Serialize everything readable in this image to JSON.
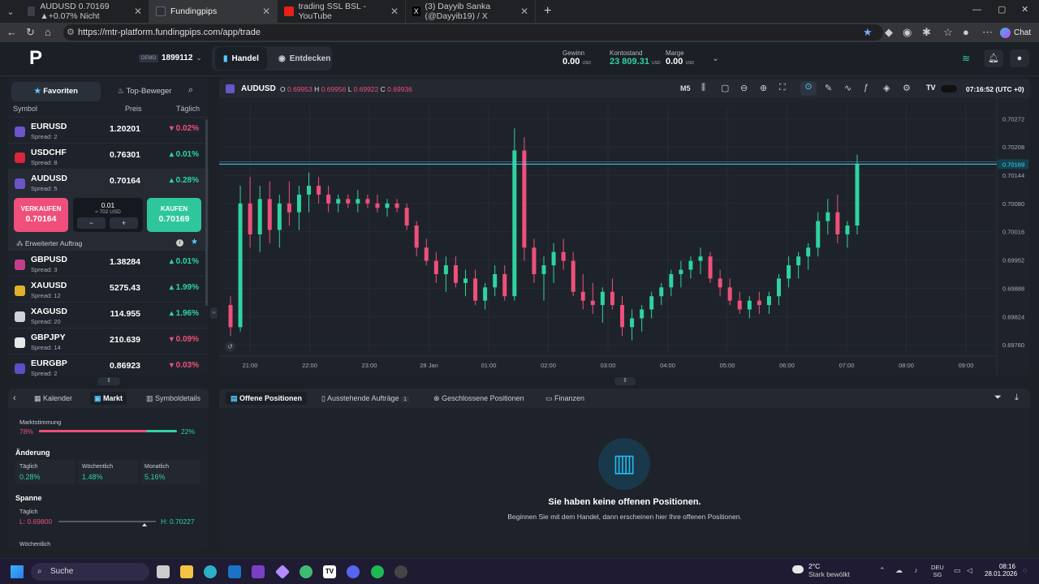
{
  "browser": {
    "tabs": [
      {
        "title": "AUDUSD 0.70169 ▲+0.07% Nicht",
        "color": "#3a3f4b"
      },
      {
        "title": "Fundingpips",
        "color": "#2b2f3a"
      },
      {
        "title": "trading SSL BSL - YouTube",
        "color": "#e62117"
      },
      {
        "title": "(3) Dayyib Sanka (@Dayyib19) / X",
        "color": "#000000"
      }
    ],
    "url": "https://mtr-platform.fundingpips.com/app/trade",
    "chat_label": "Chat"
  },
  "header": {
    "logo": "P",
    "demo_badge": "DEMO",
    "account_id": "1899112",
    "tab_trade": "Handel",
    "tab_explore": "Entdecken",
    "profit_label": "Gewinn",
    "profit_value": "0.00",
    "profit_unit": "USD",
    "balance_label": "Kontostand",
    "balance_value": "23 809.31",
    "balance_unit": "USD",
    "margin_label": "Marge",
    "margin_value": "0.00",
    "margin_unit": "USD"
  },
  "watchlist": {
    "tab_favorites": "Favoriten",
    "tab_movers": "Top-Beweger",
    "col_symbol": "Symbol",
    "col_price": "Preis",
    "col_daily": "Täglich",
    "rows": [
      {
        "symbol": "EURUSD",
        "spread": "Spread: 2",
        "price": "1.20201",
        "change": "0.02%",
        "dir": "down",
        "flag": "#6a55c9"
      },
      {
        "symbol": "USDCHF",
        "spread": "Spread: 8",
        "price": "0.76301",
        "change": "0.01%",
        "dir": "up",
        "flag": "#d7263d"
      },
      {
        "symbol": "AUDUSD",
        "spread": "Spread: 5",
        "price": "0.70164",
        "change": "0.28%",
        "dir": "up",
        "flag": "#6a55c9"
      }
    ],
    "rows2": [
      {
        "symbol": "GBPUSD",
        "spread": "Spread: 3",
        "price": "1.38284",
        "change": "0.01%",
        "dir": "up",
        "flag": "#c43d8b"
      },
      {
        "symbol": "XAUUSD",
        "spread": "Spread: 12",
        "price": "5275.43",
        "change": "1.99%",
        "dir": "up",
        "flag": "#e0b12a"
      },
      {
        "symbol": "XAGUSD",
        "spread": "Spread: 20",
        "price": "114.955",
        "change": "1.96%",
        "dir": "up",
        "flag": "#cfd3d8"
      },
      {
        "symbol": "GBPJPY",
        "spread": "Spread: 14",
        "price": "210.639",
        "change": "0.09%",
        "dir": "down",
        "flag": "#e8e8e8"
      },
      {
        "symbol": "EURGBP",
        "spread": "Spread: 2",
        "price": "0.86923",
        "change": "0.03%",
        "dir": "down",
        "flag": "#5a4fc4"
      }
    ],
    "sell_label": "VERKAUFEN",
    "sell_price": "0.70164",
    "buy_label": "KAUFEN",
    "buy_price": "0.70169",
    "lot": "0.01",
    "lot_value": "≈ 702 USD",
    "minus": "−",
    "plus": "+",
    "advanced_order": "Erweiterter Auftrag"
  },
  "chart": {
    "symbol": "AUDUSD",
    "o_label": "O",
    "o": "0.69953",
    "h_label": "H",
    "h": "0.69956",
    "l_label": "L",
    "l": "0.69922",
    "c_label": "C",
    "c": "0.69936",
    "timeframe": "M5",
    "clock": "07:16:52 (UTC +0)",
    "current_price": "0.70169"
  },
  "chart_data": {
    "type": "candlestick",
    "y_ticks": [
      "0.70272",
      "0.70208",
      "0.70144",
      "0.70080",
      "0.70016",
      "0.69952",
      "0.69888",
      "0.69824",
      "0.69760"
    ],
    "y_tick_values": [
      0.70272,
      0.70208,
      0.70144,
      0.7008,
      0.70016,
      0.69952,
      0.69888,
      0.69824,
      0.6976
    ],
    "x_ticks": [
      "21:00",
      "22:00",
      "23:00",
      "28 Jan",
      "01:00",
      "02:00",
      "03:00",
      "04:00",
      "05:00",
      "06:00",
      "07:00",
      "08:00",
      "09:00"
    ],
    "ylim": [
      0.6974,
      0.703
    ],
    "price_line": 0.70169,
    "ohlc": [
      [
        0.6985,
        0.6987,
        0.6978,
        0.698
      ],
      [
        0.698,
        0.7012,
        0.6979,
        0.7008
      ],
      [
        0.7008,
        0.7014,
        0.6998,
        0.7001
      ],
      [
        0.7001,
        0.7012,
        0.6997,
        0.7009
      ],
      [
        0.7009,
        0.7013,
        0.6999,
        0.7002
      ],
      [
        0.7002,
        0.701,
        0.6998,
        0.7008
      ],
      [
        0.7008,
        0.7013,
        0.7003,
        0.7006
      ],
      [
        0.7006,
        0.7012,
        0.7002,
        0.701
      ],
      [
        0.701,
        0.7015,
        0.7006,
        0.7012
      ],
      [
        0.7012,
        0.7014,
        0.7008,
        0.701
      ],
      [
        0.701,
        0.7012,
        0.7006,
        0.7008
      ],
      [
        0.7008,
        0.701,
        0.7006,
        0.7009
      ],
      [
        0.7009,
        0.701,
        0.7007,
        0.7008
      ],
      [
        0.7008,
        0.7011,
        0.7006,
        0.7009
      ],
      [
        0.7009,
        0.701,
        0.7007,
        0.7008
      ],
      [
        0.7008,
        0.701,
        0.7006,
        0.7007
      ],
      [
        0.7007,
        0.7009,
        0.7005,
        0.7008
      ],
      [
        0.7008,
        0.7009,
        0.7006,
        0.7007
      ],
      [
        0.7007,
        0.7008,
        0.7002,
        0.7003
      ],
      [
        0.7003,
        0.7004,
        0.6996,
        0.6998
      ],
      [
        0.6998,
        0.7,
        0.6994,
        0.6995
      ],
      [
        0.6995,
        0.6997,
        0.699,
        0.6992
      ],
      [
        0.6992,
        0.6996,
        0.6988,
        0.6994
      ],
      [
        0.6994,
        0.6996,
        0.6989,
        0.699
      ],
      [
        0.699,
        0.6993,
        0.6987,
        0.6991
      ],
      [
        0.6991,
        0.6993,
        0.6985,
        0.6986
      ],
      [
        0.6986,
        0.699,
        0.6984,
        0.6989
      ],
      [
        0.6989,
        0.6994,
        0.6987,
        0.6992
      ],
      [
        0.6992,
        0.6994,
        0.6986,
        0.6987
      ],
      [
        0.6987,
        0.7025,
        0.6986,
        0.702
      ],
      [
        0.702,
        0.7023,
        0.6995,
        0.6998
      ],
      [
        0.6998,
        0.7,
        0.699,
        0.6992
      ],
      [
        0.6992,
        0.6996,
        0.6986,
        0.6994
      ],
      [
        0.6994,
        0.6999,
        0.699,
        0.6997
      ],
      [
        0.6997,
        0.7,
        0.6993,
        0.6995
      ],
      [
        0.6995,
        0.6997,
        0.6987,
        0.6988
      ],
      [
        0.6988,
        0.6992,
        0.6984,
        0.6986
      ],
      [
        0.6986,
        0.699,
        0.6983,
        0.6985
      ],
      [
        0.6985,
        0.6989,
        0.6981,
        0.6988
      ],
      [
        0.6988,
        0.6991,
        0.6984,
        0.6985
      ],
      [
        0.6985,
        0.6987,
        0.6978,
        0.698
      ],
      [
        0.698,
        0.6984,
        0.6977,
        0.6982
      ],
      [
        0.6982,
        0.6985,
        0.6979,
        0.6984
      ],
      [
        0.6984,
        0.6988,
        0.6982,
        0.6987
      ],
      [
        0.6987,
        0.699,
        0.6985,
        0.6989
      ],
      [
        0.6989,
        0.6993,
        0.6987,
        0.6992
      ],
      [
        0.6992,
        0.6995,
        0.6989,
        0.6993
      ],
      [
        0.6993,
        0.6996,
        0.6991,
        0.6995
      ],
      [
        0.6995,
        0.6998,
        0.6992,
        0.6996
      ],
      [
        0.6996,
        0.6997,
        0.699,
        0.6991
      ],
      [
        0.6991,
        0.6993,
        0.6987,
        0.6989
      ],
      [
        0.6989,
        0.6991,
        0.6985,
        0.6986
      ],
      [
        0.6986,
        0.6988,
        0.6983,
        0.6984
      ],
      [
        0.6984,
        0.6987,
        0.6982,
        0.6986
      ],
      [
        0.6986,
        0.6988,
        0.6983,
        0.6985
      ],
      [
        0.6985,
        0.6988,
        0.6983,
        0.6987
      ],
      [
        0.6987,
        0.6992,
        0.6985,
        0.6991
      ],
      [
        0.6991,
        0.6996,
        0.6989,
        0.6994
      ],
      [
        0.6994,
        0.6997,
        0.6991,
        0.6996
      ],
      [
        0.6996,
        0.6999,
        0.6993,
        0.6998
      ],
      [
        0.6998,
        0.7006,
        0.6996,
        0.7004
      ],
      [
        0.7004,
        0.7009,
        0.7001,
        0.7006
      ],
      [
        0.7006,
        0.701,
        0.6999,
        0.7001
      ],
      [
        0.7001,
        0.7004,
        0.6998,
        0.7003
      ],
      [
        0.7003,
        0.7019,
        0.7001,
        0.7017
      ]
    ]
  },
  "bottom_tabs": {
    "open": "Offene Positionen",
    "pending": "Ausstehende Aufträge",
    "pending_count": "1",
    "closed": "Geschlossene Positionen",
    "finance": "Finanzen"
  },
  "empty_state": {
    "title": "Sie haben keine offenen Positionen.",
    "subtitle": "Beginnen Sie mit dem Handel, dann erscheinen hier Ihre offenen Positionen."
  },
  "market_panel": {
    "tab_calendar": "Kalender",
    "tab_market": "Markt",
    "tab_details": "Symboldetails",
    "sentiment_label": "Marktstimmung",
    "sentiment_sell": "78%",
    "sentiment_buy": "22%",
    "sentiment_sell_fraction": 0.78,
    "change_label": "Änderung",
    "daily_label": "Täglich",
    "daily_value": "0.28%",
    "weekly_label": "Wöchentlich",
    "weekly_value": "1.48%",
    "monthly_label": "Monatlich",
    "monthly_value": "5.16%",
    "range_label": "Spanne",
    "range_daily_label": "Täglich",
    "range_low": "L: 0.69800",
    "range_high": "H: 0.70227",
    "range_position_fraction": 0.88,
    "range_weekly_label": "Wöchentlich"
  },
  "taskbar": {
    "search": "Suche",
    "weather_temp": "2°C",
    "weather_desc": "Stark bewölkt",
    "lang1": "DEU",
    "lang2": "SG",
    "time": "08:16",
    "date": "28.01.2026"
  }
}
